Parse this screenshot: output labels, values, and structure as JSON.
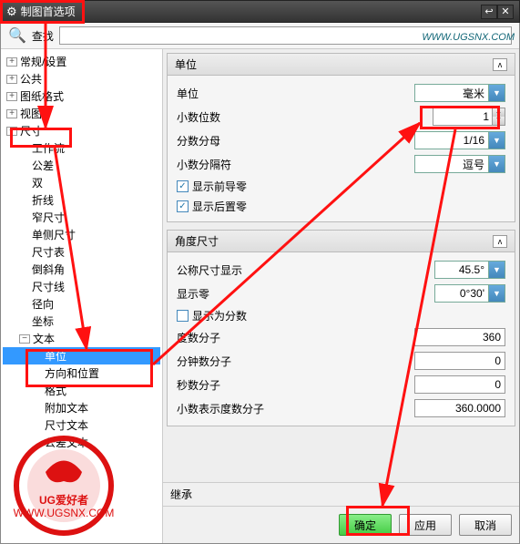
{
  "title": "制图首选项",
  "search_label": "查找",
  "tree": {
    "n0": "常规/设置",
    "n1": "公共",
    "n2": "图纸格式",
    "n3": "视图",
    "n4": "尺寸",
    "d0": "工作流",
    "d1": "公差",
    "d2": "双",
    "d3": "折线",
    "d4": "窄尺寸",
    "d5": "单侧尺寸",
    "d6": "尺寸表",
    "d7": "倒斜角",
    "d8": "尺寸线",
    "d9": "径向",
    "d10": "坐标",
    "t0": "文本",
    "t1": "单位",
    "t2": "方向和位置",
    "t3": "格式",
    "t4": "附加文本",
    "t5": "尺寸文本",
    "t6": "公差文本"
  },
  "grp_units": "单位",
  "f_unit": "单位",
  "v_unit": "毫米",
  "f_dec": "小数位数",
  "v_dec": "1",
  "f_frac": "分数分母",
  "v_frac": "1/16",
  "f_sep": "小数分隔符",
  "v_sep": "逗号",
  "c_lead": "显示前导零",
  "c_trail": "显示后置零",
  "grp_ang": "角度尺寸",
  "f_nom": "公称尺寸显示",
  "v_nom": "45.5°",
  "f_zero": "显示零",
  "v_zero": "0°30'",
  "c_asfrac": "显示为分数",
  "f_degn": "度数分子",
  "v_degn": "360",
  "f_minn": "分钟数分子",
  "v_minn": "0",
  "f_secn": "秒数分子",
  "v_secn": "0",
  "f_decdeg": "小数表示度数分子",
  "v_decdeg": "360.0000",
  "inherit": "继承",
  "btn_ok": "确定",
  "btn_apply": "应用",
  "btn_cancel": "取消",
  "wm": "WWW.UGSNX.COM",
  "stamp_text": "UG爱好者",
  "stamp_url": "WWW.UGSNX.COM"
}
